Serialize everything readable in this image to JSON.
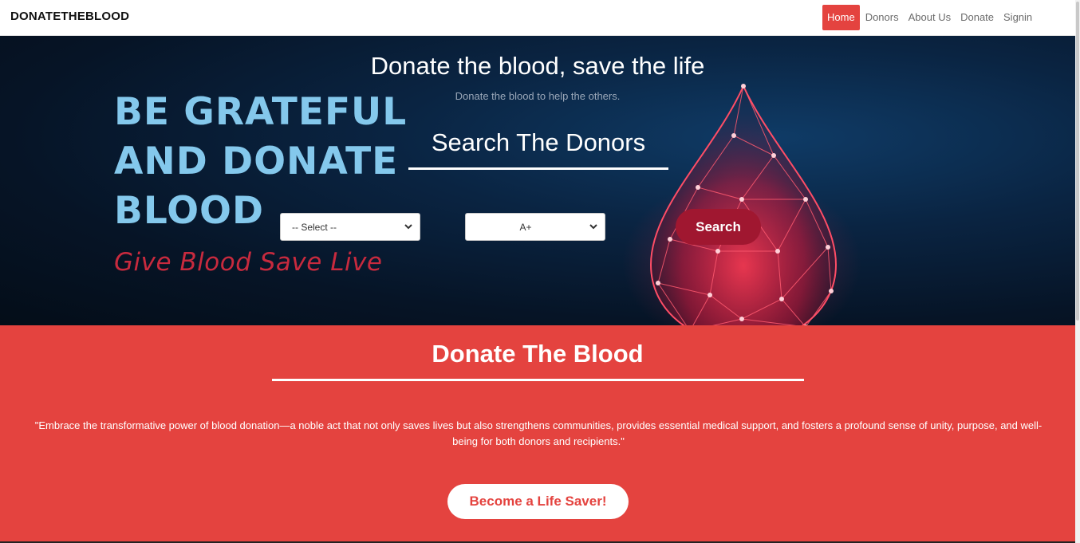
{
  "navbar": {
    "brand": "DONATETHEBLOOD",
    "links": [
      {
        "label": "Home",
        "active": true
      },
      {
        "label": "Donors",
        "active": false
      },
      {
        "label": "About Us",
        "active": false
      },
      {
        "label": "Donate",
        "active": false
      },
      {
        "label": "Signin",
        "active": false
      }
    ]
  },
  "hero": {
    "title": "Donate the blood, save the life",
    "subtitle": "Donate the blood to help the others.",
    "poster": {
      "lines": [
        "BE GRATEFUL",
        "AND DONATE",
        "BLOOD"
      ],
      "tagline": "Give Blood  Save Live"
    },
    "search": {
      "heading": "Search The Donors",
      "city_select": "-- Select --",
      "blood_group_select": "A+",
      "button": "Search"
    }
  },
  "section": {
    "title": "Donate The Blood",
    "quote": "\"Embrace the transformative power of blood donation—a noble act that not only saves lives but also strengthens communities, provides essential medical support, and fosters a profound sense of unity, purpose, and well-being for both donors and recipients.\"",
    "cta": "Become a Life Saver!"
  },
  "colors": {
    "accent": "#e4433f",
    "search_button": "#a01730",
    "poster_text": "#84c8ec",
    "poster_tagline": "#c72a3e",
    "hero_background": "#0a2442"
  }
}
